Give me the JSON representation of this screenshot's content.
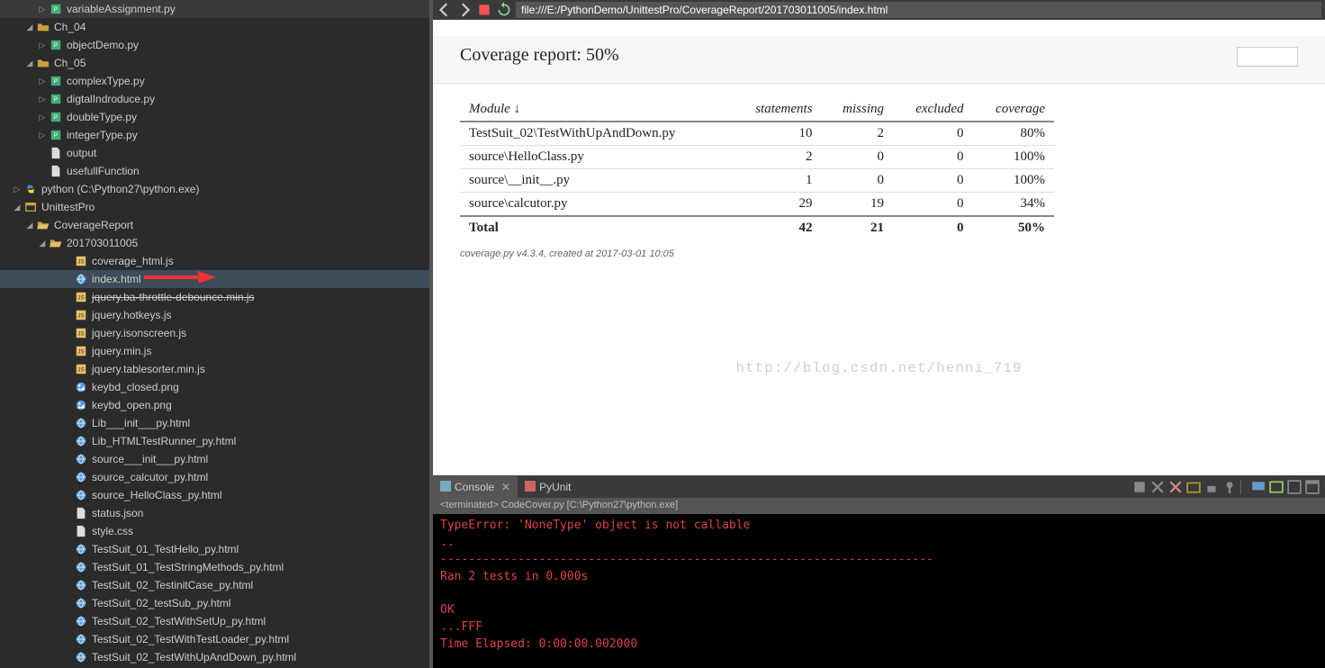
{
  "tree": [
    {
      "indent": 28,
      "arrow": "▷",
      "icon": "py",
      "label": "variableAssignment.py"
    },
    {
      "indent": 14,
      "arrow": "◢",
      "icon": "folder",
      "label": "Ch_04"
    },
    {
      "indent": 28,
      "arrow": "▷",
      "icon": "py",
      "label": "objectDemo.py"
    },
    {
      "indent": 14,
      "arrow": "◢",
      "icon": "folder",
      "label": "Ch_05"
    },
    {
      "indent": 28,
      "arrow": "▷",
      "icon": "py",
      "label": "complexType.py"
    },
    {
      "indent": 28,
      "arrow": "▷",
      "icon": "py",
      "label": "digtalIndroduce.py"
    },
    {
      "indent": 28,
      "arrow": "▷",
      "icon": "py",
      "label": "doubleType.py"
    },
    {
      "indent": 28,
      "arrow": "▷",
      "icon": "py",
      "label": "integerType.py"
    },
    {
      "indent": 28,
      "arrow": "",
      "icon": "file",
      "label": "output"
    },
    {
      "indent": 28,
      "arrow": "",
      "icon": "file",
      "label": "usefullFunction"
    },
    {
      "indent": 0,
      "arrow": "▷",
      "icon": "pyenv",
      "label": "python  (C:\\Python27\\python.exe)"
    },
    {
      "indent": 0,
      "arrow": "◢",
      "icon": "proj",
      "label": "UnittestPro"
    },
    {
      "indent": 14,
      "arrow": "◢",
      "icon": "folder-open",
      "label": "CoverageReport"
    },
    {
      "indent": 28,
      "arrow": "◢",
      "icon": "folder-open",
      "label": "201703011005"
    },
    {
      "indent": 56,
      "arrow": "",
      "icon": "js",
      "label": "coverage_html.js"
    },
    {
      "indent": 56,
      "arrow": "",
      "icon": "html",
      "label": "index.html",
      "selected": true
    },
    {
      "indent": 56,
      "arrow": "",
      "icon": "js",
      "label": "jquery.ba-throttle-debounce.min.js",
      "strike": true
    },
    {
      "indent": 56,
      "arrow": "",
      "icon": "js",
      "label": "jquery.hotkeys.js"
    },
    {
      "indent": 56,
      "arrow": "",
      "icon": "js",
      "label": "jquery.isonscreen.js"
    },
    {
      "indent": 56,
      "arrow": "",
      "icon": "js",
      "label": "jquery.min.js"
    },
    {
      "indent": 56,
      "arrow": "",
      "icon": "js",
      "label": "jquery.tablesorter.min.js"
    },
    {
      "indent": 56,
      "arrow": "",
      "icon": "img",
      "label": "keybd_closed.png"
    },
    {
      "indent": 56,
      "arrow": "",
      "icon": "img",
      "label": "keybd_open.png"
    },
    {
      "indent": 56,
      "arrow": "",
      "icon": "html",
      "label": "Lib___init___py.html"
    },
    {
      "indent": 56,
      "arrow": "",
      "icon": "html",
      "label": "Lib_HTMLTestRunner_py.html"
    },
    {
      "indent": 56,
      "arrow": "",
      "icon": "html",
      "label": "source___init___py.html"
    },
    {
      "indent": 56,
      "arrow": "",
      "icon": "html",
      "label": "source_calcutor_py.html"
    },
    {
      "indent": 56,
      "arrow": "",
      "icon": "html",
      "label": "source_HelloClass_py.html"
    },
    {
      "indent": 56,
      "arrow": "",
      "icon": "file",
      "label": "status.json"
    },
    {
      "indent": 56,
      "arrow": "",
      "icon": "file",
      "label": "style.css"
    },
    {
      "indent": 56,
      "arrow": "",
      "icon": "html",
      "label": "TestSuit_01_TestHello_py.html"
    },
    {
      "indent": 56,
      "arrow": "",
      "icon": "html",
      "label": "TestSuit_01_TestStringMethods_py.html"
    },
    {
      "indent": 56,
      "arrow": "",
      "icon": "html",
      "label": "TestSuit_02_TestinitCase_py.html"
    },
    {
      "indent": 56,
      "arrow": "",
      "icon": "html",
      "label": "TestSuit_02_testSub_py.html"
    },
    {
      "indent": 56,
      "arrow": "",
      "icon": "html",
      "label": "TestSuit_02_TestWithSetUp_py.html"
    },
    {
      "indent": 56,
      "arrow": "",
      "icon": "html",
      "label": "TestSuit_02_TestWithTestLoader_py.html"
    },
    {
      "indent": 56,
      "arrow": "",
      "icon": "html",
      "label": "TestSuit_02_TestWithUpAndDown_py.html"
    }
  ],
  "url": "file:///E:/PythonDemo/UnittestPro/CoverageReport/201703011005/index.html",
  "coverage": {
    "title": "Coverage report: 50%",
    "headers": {
      "module": "Module",
      "statements": "statements",
      "missing": "missing",
      "excluded": "excluded",
      "coverage": "coverage"
    },
    "sort_indicator": "↓",
    "rows": [
      {
        "module": "TestSuit_02\\TestWithUpAndDown.py",
        "statements": "10",
        "missing": "2",
        "excluded": "0",
        "coverage": "80%"
      },
      {
        "module": "source\\HelloClass.py",
        "statements": "2",
        "missing": "0",
        "excluded": "0",
        "coverage": "100%"
      },
      {
        "module": "source\\__init__.py",
        "statements": "1",
        "missing": "0",
        "excluded": "0",
        "coverage": "100%"
      },
      {
        "module": "source\\calcutor.py",
        "statements": "29",
        "missing": "19",
        "excluded": "0",
        "coverage": "34%"
      }
    ],
    "total": {
      "module": "Total",
      "statements": "42",
      "missing": "21",
      "excluded": "0",
      "coverage": "50%"
    },
    "footer": "coverage.py v4.3.4, created at 2017-03-01 10:05"
  },
  "watermark": "http://blog.csdn.net/henni_719",
  "console": {
    "tab_console": "Console",
    "tab_pyunit": "PyUnit",
    "status": "<terminated>  CodeCover.py [C:\\Python27\\python.exe]",
    "lines": [
      "TypeError: 'NoneType' object is not callable",
      "..",
      "----------------------------------------------------------------------",
      "Ran 2 tests in 0.000s",
      "",
      "OK",
      "...FFF",
      "Time Elapsed: 0:00:00.002000"
    ]
  }
}
